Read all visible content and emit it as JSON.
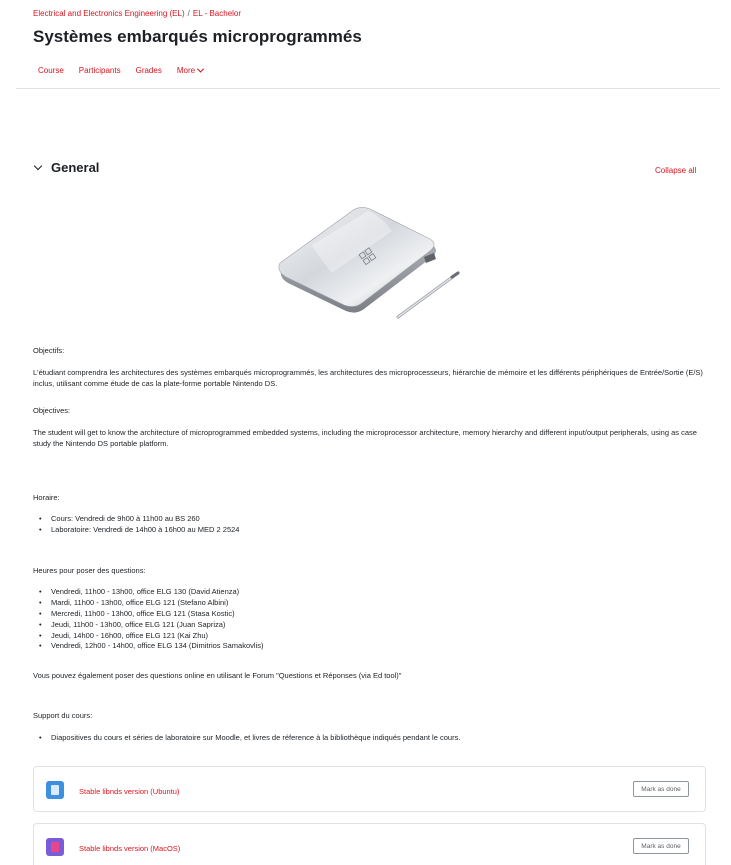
{
  "breadcrumb": {
    "items": [
      "Electrical and Electronics Engineering (EL)",
      "EL - Bachelor"
    ],
    "separator": "/"
  },
  "course": {
    "title": "Systèmes embarqués microprogrammés"
  },
  "nav": {
    "tabs": [
      "Course",
      "Participants",
      "Grades",
      "More"
    ]
  },
  "section": {
    "title": "General",
    "collapse_all": "Collapse all"
  },
  "content": {
    "objectifs_label": "Objectifs:",
    "objectifs_text": "L'étudiant comprendra les architectures des systèmes embarqués microprogrammés, les architectures des microprocesseurs, hiérarchie de mémoire et les différents périphériques de Entrée/Sortie (E/S) inclus, utilisant comme étude de cas la plate-forme portable Nintendo DS.",
    "objectives_label": "Objectives:",
    "objectives_text": "The student will get to know the architecture of microprogrammed embedded systems, including the microprocessor architecture, memory hierarchy and different input/output peripherals, using as case study the Nintendo DS portable platform.",
    "horaire_label": "Horaire:",
    "horaire_items": [
      "Cours: Vendredi de 9h00 à 11h00 au BS 260",
      "Laboratoire: Vendredi de 14h00 à 16h00 au MED 2 2524"
    ],
    "heures_label": "Heures pour poser des questions:",
    "heures_items": [
      "Vendredi, 11h00 - 13h00, office ELG 130 (David Atienza)",
      "Mardi, 11h00 - 13h00, office ELG 121 (Stefano Albini)",
      "Mercredi, 11h00 - 13h00, office ELG 121 (Stasa Kostic)",
      "Jeudi, 11h00 - 13h00, office ELG 121 (Juan Sapriza)",
      "Jeudi, 14h00 - 16h00, office ELG 121 (Kai Zhu)",
      "Vendredi, 12h00 - 14h00, office ELG 134 (Dimitrios Samakovlis)"
    ],
    "forum_text": "Vous pouvez également poser des questions online en utilisant le Forum \"Questions et Réponses (via Ed tool)\"",
    "support_label": "Support du cours:",
    "support_items": [
      "Diapositives du cours et séries de laboratoire sur Moodle, et livres de réference à la bibliothèque indiqués pendant le cours."
    ]
  },
  "activities": [
    {
      "name": "Stable libnds version (Ubuntu)",
      "button": "Mark as done",
      "icon": "file-icon",
      "icon_color": "#3d8fe0"
    },
    {
      "name": "Stable libnds version (MacOS)",
      "button": "Mark as done",
      "icon": "file-icon",
      "icon_color": "#7a5bd8"
    }
  ],
  "colors": {
    "accent": "#d9141e",
    "text": "#1d2125",
    "border": "#dee2e6"
  }
}
